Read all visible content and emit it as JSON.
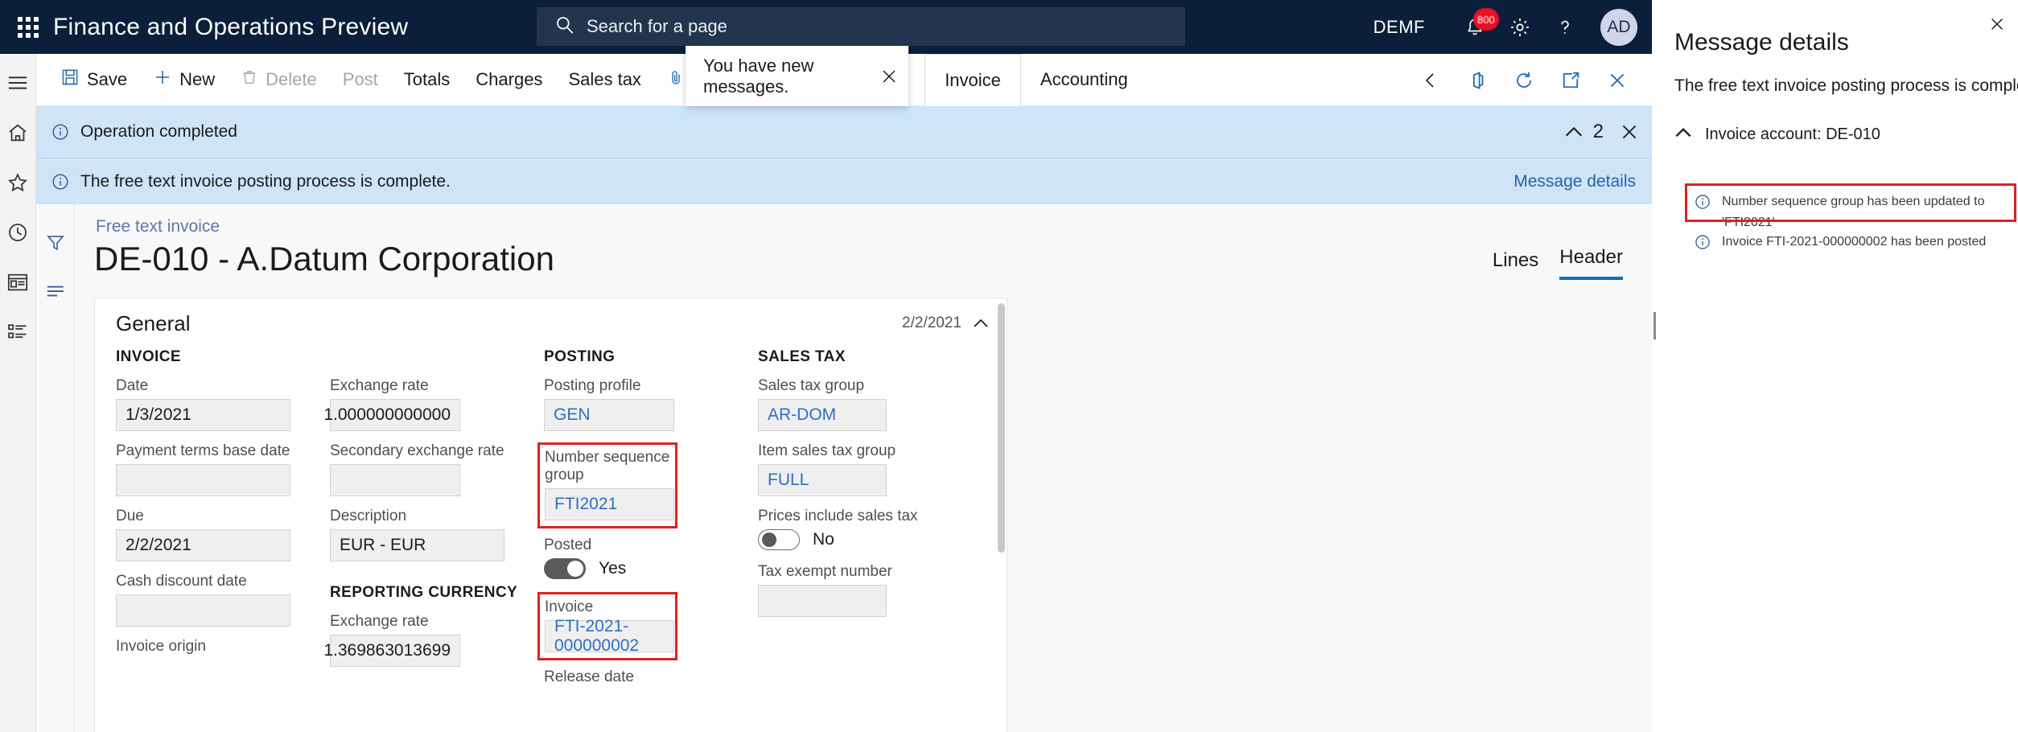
{
  "topbar": {
    "waffle_icon": "waffle-grid-icon",
    "app_title": "Finance and Operations Preview",
    "search": {
      "placeholder": "Search for a page",
      "icon": "search-icon"
    },
    "legal_entity": "DEMF",
    "notification_badge": "800",
    "notification_icon": "bell-icon",
    "settings_icon": "gear-icon",
    "help_icon": "question-mark-icon",
    "avatar_initials": "AD"
  },
  "rail": {
    "items": [
      {
        "icon": "hamburger-menu-icon",
        "name": "nav-menu"
      },
      {
        "icon": "home-icon",
        "name": "home"
      },
      {
        "icon": "star-icon",
        "name": "favorites"
      },
      {
        "icon": "clock-icon",
        "name": "recent"
      },
      {
        "icon": "workspace-icon",
        "name": "workspaces"
      },
      {
        "icon": "list-icon",
        "name": "modules"
      }
    ]
  },
  "toolbar": {
    "buttons": [
      {
        "label": "Save",
        "icon": "save-disk-icon",
        "disabled": false
      },
      {
        "label": "New",
        "icon": "plus-icon",
        "disabled": false
      },
      {
        "label": "Delete",
        "icon": "trash-icon",
        "disabled": true
      },
      {
        "label": "Post",
        "icon": "",
        "disabled": true
      },
      {
        "label": "Totals",
        "icon": "",
        "disabled": false
      },
      {
        "label": "Charges",
        "icon": "",
        "disabled": false
      },
      {
        "label": "Sales tax",
        "icon": "",
        "disabled": false
      },
      {
        "label": "Notes and attachments (0)",
        "icon": "paperclip-icon",
        "disabled": false
      }
    ],
    "tabs": [
      {
        "label": "Invoice",
        "active": true
      },
      {
        "label": "Accounting",
        "active": false
      }
    ],
    "right_icons": [
      {
        "icon": "office-app-icon",
        "name": "open-in-office"
      },
      {
        "icon": "refresh-icon",
        "name": "refresh"
      },
      {
        "icon": "popout-icon",
        "name": "open-in-new-window"
      },
      {
        "icon": "close-icon",
        "name": "close-page"
      }
    ]
  },
  "toast": {
    "message": "You have new messages.",
    "close_icon": "close-icon"
  },
  "messagebar": {
    "primary": "Operation completed",
    "secondary": "The free text invoice posting process is complete.",
    "info_icon": "info-circle-icon",
    "count": "2",
    "collapse_icon": "chevron-up-icon",
    "close_icon": "close-icon",
    "details_link": "Message details"
  },
  "filter_rail": {
    "items": [
      {
        "icon": "filter-funnel-icon",
        "name": "filter-pane"
      },
      {
        "icon": "lines-icon",
        "name": "related-information"
      }
    ]
  },
  "page": {
    "breadcrumb": "Free text invoice",
    "title": "DE-010 - A.Datum Corporation",
    "tabs": [
      {
        "label": "Lines",
        "active": false
      },
      {
        "label": "Header",
        "active": true
      }
    ]
  },
  "general_card": {
    "title": "General",
    "date": "2/2/2021",
    "collapse_icon": "chevron-up-icon",
    "columns": [
      {
        "heading": "INVOICE",
        "fields": [
          {
            "label": "Date",
            "value": "1/3/2021",
            "style": "text",
            "width": "w217"
          },
          {
            "label": "Payment terms base date",
            "value": "",
            "style": "text",
            "width": "w217"
          },
          {
            "label": "Due",
            "value": "2/2/2021",
            "style": "text",
            "width": "w217"
          },
          {
            "label": "Cash discount date",
            "value": "",
            "style": "text",
            "width": "w217"
          },
          {
            "label": "Invoice origin",
            "value": "",
            "style": "label-only",
            "width": "w217"
          }
        ]
      },
      {
        "heading": "",
        "fields": [
          {
            "label": "Exchange rate",
            "value": "1.000000000000",
            "style": "num",
            "width": "w162"
          },
          {
            "label": "Secondary exchange rate",
            "value": "",
            "style": "num",
            "width": "w162"
          },
          {
            "label": "Description",
            "value": "EUR - EUR",
            "style": "text",
            "width": "w217"
          }
        ],
        "subgroup": {
          "heading": "REPORTING CURRENCY",
          "fields": [
            {
              "label": "Exchange rate",
              "value": "1.369863013699",
              "style": "num",
              "width": "w162"
            }
          ]
        }
      },
      {
        "heading": "POSTING",
        "fields": [
          {
            "label": "Posting profile",
            "value": "GEN",
            "style": "link",
            "width": "w162",
            "highlight": false
          },
          {
            "label": "Number sequence group",
            "value": "FTI2021",
            "style": "link",
            "width": "w161",
            "highlight": true
          },
          {
            "label": "Posted",
            "value": "Yes",
            "style": "toggle-on",
            "width": ""
          },
          {
            "label": "Invoice",
            "value": "FTI-2021-000000002",
            "style": "link",
            "width": "w161",
            "highlight": true
          },
          {
            "label": "Release date",
            "value": "",
            "style": "label-only",
            "width": "w162"
          }
        ]
      },
      {
        "heading": "SALES TAX",
        "fields": [
          {
            "label": "Sales tax group",
            "value": "AR-DOM",
            "style": "link",
            "width": "w160"
          },
          {
            "label": "Item sales tax group",
            "value": "FULL",
            "style": "link",
            "width": "w160"
          },
          {
            "label": "Prices include sales tax",
            "value": "No",
            "style": "toggle-off",
            "width": ""
          },
          {
            "label": "Tax exempt number",
            "value": "",
            "style": "text",
            "width": "w160"
          }
        ]
      }
    ]
  },
  "details_pane": {
    "title": "Message details",
    "summary": "The free text invoice posting process is complete.",
    "group_label": "Invoice account: DE-010",
    "group_collapse_icon": "chevron-up-icon",
    "items": [
      {
        "text": "Number sequence group has been updated to 'FTI2021'",
        "icon": "info-circle-icon",
        "highlight": true
      },
      {
        "text": "Invoice FTI-2021-000000002 has been posted",
        "icon": "info-circle-icon",
        "highlight": false
      }
    ]
  },
  "colors": {
    "navy": "#0b1f3a",
    "accent_blue": "#0f6cbd",
    "link_blue": "#2e6fc2",
    "message_bar": "#cfe4f7",
    "highlight_red": "#e02020",
    "badge_red": "#e81123"
  }
}
